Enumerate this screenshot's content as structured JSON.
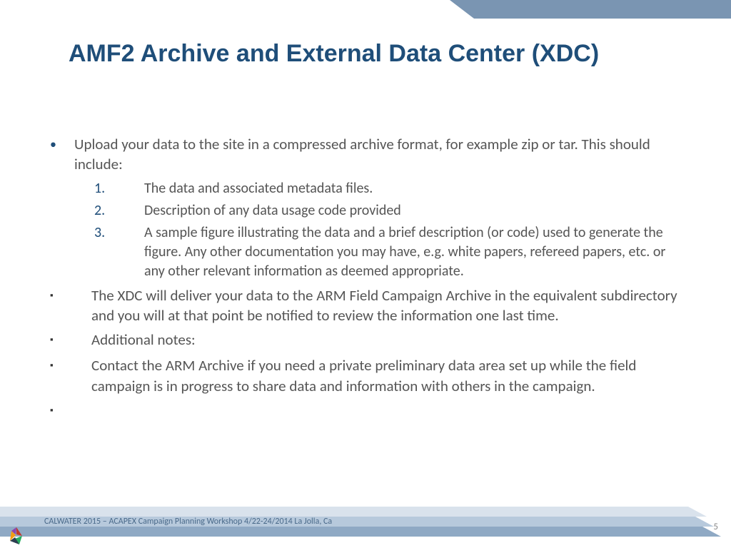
{
  "title": "AMF2 Archive and External Data Center (XDC)",
  "bullet1": "Upload your data to the site in a compressed archive format, for example zip or tar. This should include:",
  "num1": "1.",
  "num1_text": "The data and associated metadata files.",
  "num2": "2.",
  "num2_text": "Description of any data usage code provided",
  "num3": "3.",
  "num3_text": "A sample figure illustrating the data and a brief description (or code) used to generate the figure.  Any other documentation you may have, e.g. white papers, refereed papers, etc. or any other relevant information as deemed appropriate.",
  "bullet2": "The XDC will deliver your data to the ARM Field Campaign Archive in the equivalent subdirectory and you will at that point be notified to review the information one last time.",
  "bullet3": "Additional notes:",
  "bullet4": "Contact the ARM Archive if you need a private preliminary data area set up while the field campaign is in progress to share data and information with others in the campaign.",
  "bullet5": "",
  "footer": "CALWATER 2015 – ACAPEX Campaign Planning Workshop 4/22-24/2014 La Jolla, Ca",
  "page": "5"
}
